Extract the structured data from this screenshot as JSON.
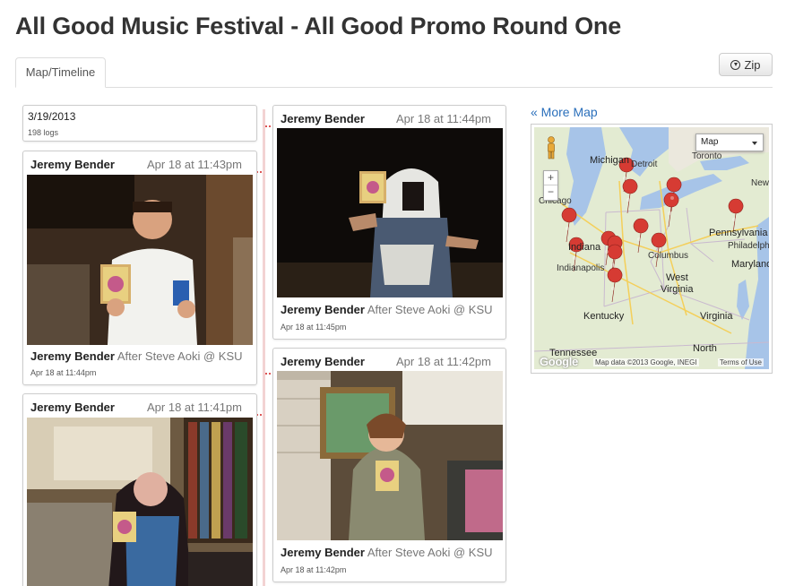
{
  "page": {
    "title": "All Good Music Festival - All Good Promo Round One"
  },
  "tabs": [
    {
      "label": "Map/Timeline",
      "active": true
    }
  ],
  "toolbar": {
    "zip_label": "Zip"
  },
  "timeline": {
    "date_card": {
      "date": "3/19/2013",
      "logs": "198 logs"
    },
    "posts": [
      {
        "author": "Jeremy Bender",
        "time": "Apr 18 at 11:44pm",
        "caption": "After Steve Aoki @ KSU",
        "subtime": "Apr 18 at 11:45pm",
        "column": "right"
      },
      {
        "author": "Jeremy Bender",
        "time": "Apr 18 at 11:43pm",
        "caption": "After Steve Aoki @ KSU",
        "subtime": "Apr 18 at 11:44pm",
        "column": "left"
      },
      {
        "author": "Jeremy Bender",
        "time": "Apr 18 at 11:42pm",
        "caption": "After Steve Aoki @ KSU",
        "subtime": "Apr 18 at 11:42pm",
        "column": "right"
      },
      {
        "author": "Jeremy Bender",
        "time": "Apr 18 at 11:41pm",
        "caption": "",
        "subtime": "",
        "column": "left"
      }
    ]
  },
  "map": {
    "more_link": "« More Map",
    "type_select": "Map",
    "zoom_in": "+",
    "zoom_out": "−",
    "labels": {
      "michigan": "Michigan",
      "detroit": "Detroit",
      "toronto": "Toronto",
      "chicago": "Chicago",
      "new": "New",
      "pennsylvania": "Pennsylvania",
      "philadelphia": "Philadelph",
      "indiana": "Indiana",
      "indianapolis": "Indianapolis",
      "columbus": "Columbus",
      "maryland": "Maryland",
      "west": "West",
      "virginia_wv": "Virginia",
      "kentucky": "Kentucky",
      "virginia": "Virginia",
      "tennessee": "Tennessee",
      "north": "North"
    },
    "google": "Google",
    "copyright": "Map data ©2013 Google, INEGI",
    "terms": "Terms of Use",
    "colors": {
      "water": "#a7c4e8",
      "land": "#e3ebd2",
      "pin": "#d63b33",
      "road": "#f4cf5a"
    }
  }
}
